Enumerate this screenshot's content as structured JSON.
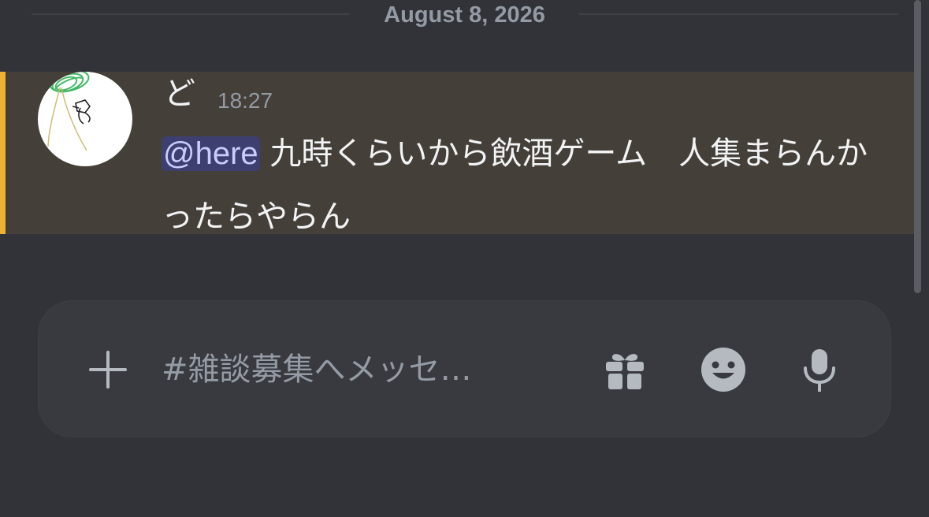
{
  "divider": {
    "date": "August 8, 2026"
  },
  "message": {
    "author": "ど",
    "time": "18:27",
    "mention": "@here",
    "text": " 九時くらいから飲酒ゲーム　人集まらんかったらやらん",
    "highlighted": true,
    "highlight_color": "#f0b232"
  },
  "composer": {
    "placeholder": "#雑談募集へメッセ…",
    "icons": {
      "add": "plus-icon",
      "gift": "gift-icon",
      "emoji": "emoji-icon",
      "mic": "microphone-icon"
    }
  },
  "colors": {
    "background": "#313338",
    "mention_background": "#443f38",
    "mention_pill": "#3d3f70",
    "text": "#f2f3f5",
    "muted": "#949ba4",
    "icon": "#b5bac1"
  }
}
